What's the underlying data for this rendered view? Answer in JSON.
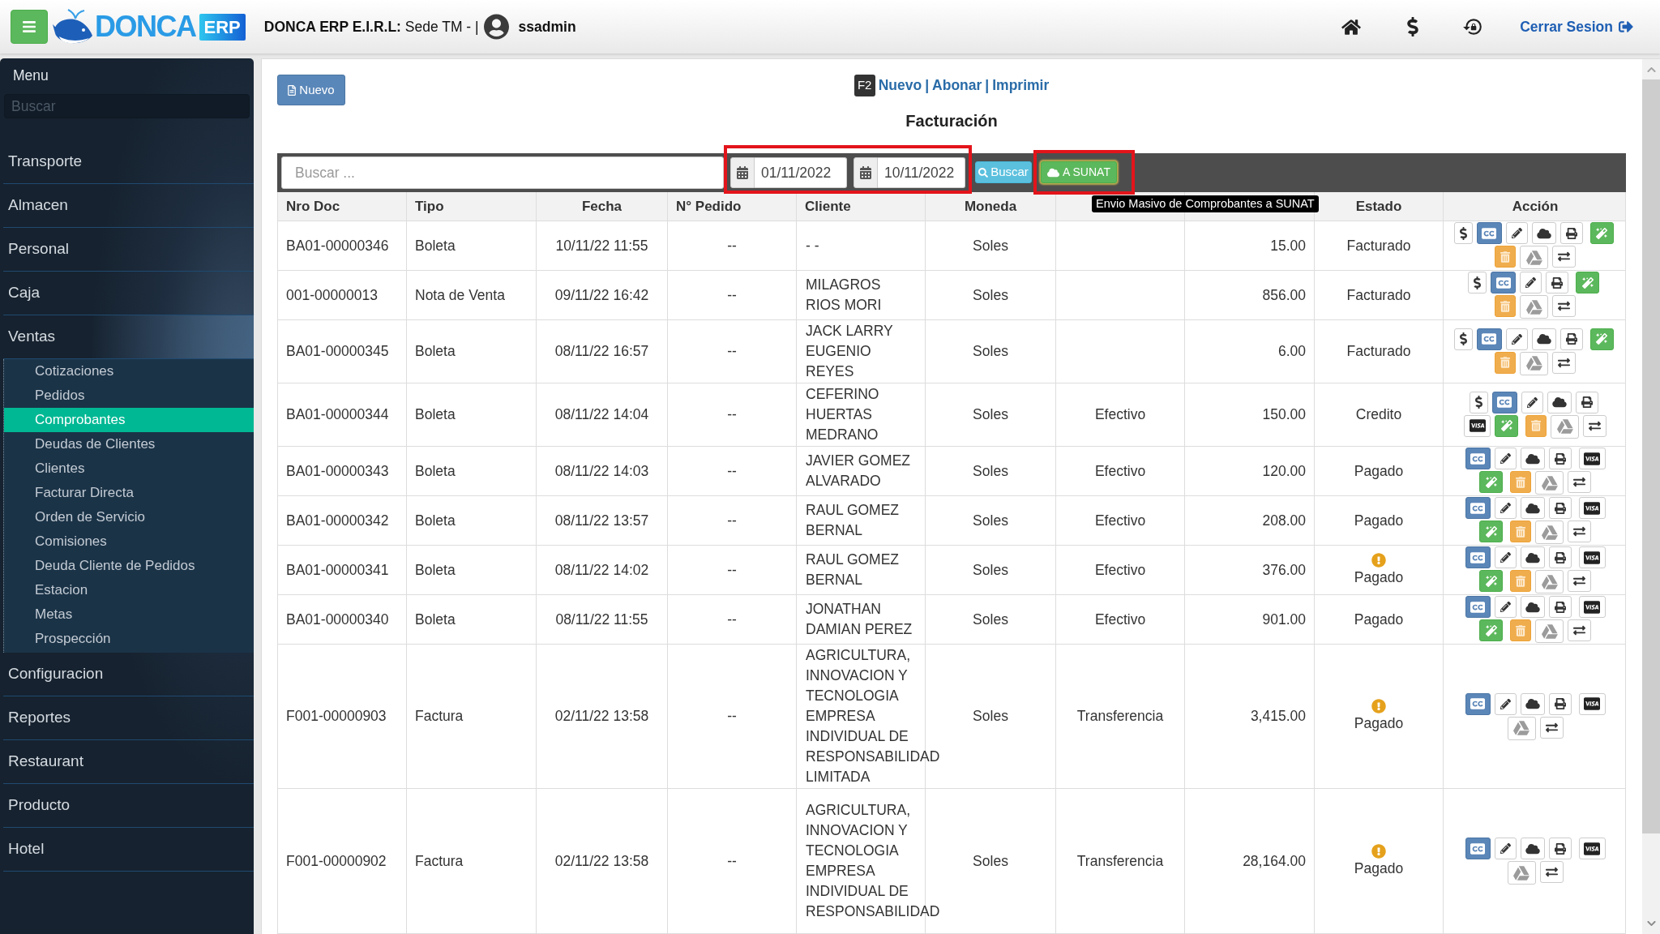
{
  "header": {
    "brand": {
      "name": "DONCA",
      "badge": "ERP"
    },
    "company": "**DONCA ERP E.I.R.L:** Sede TM - |",
    "user": "ssadmin",
    "logout": "Cerrar Sesion"
  },
  "sidebar": {
    "title": "Menu",
    "search": {
      "placeholder": "Buscar"
    },
    "items": [
      {
        "label": "Transporte",
        "expanded": false
      },
      {
        "label": "Almacen",
        "expanded": false
      },
      {
        "label": "Personal",
        "expanded": false
      },
      {
        "label": "Caja",
        "expanded": false
      },
      {
        "label": "Ventas",
        "expanded": true,
        "children": [
          {
            "label": "Cotizaciones",
            "selected": false
          },
          {
            "label": "Pedidos",
            "selected": false
          },
          {
            "label": "Comprobantes",
            "selected": true
          },
          {
            "label": "Deudas de Clientes",
            "selected": false
          },
          {
            "label": "Clientes",
            "selected": false
          },
          {
            "label": "Facturar Directa",
            "selected": false
          },
          {
            "label": "Orden de Servicio",
            "selected": false
          },
          {
            "label": "Comisiones",
            "selected": false
          },
          {
            "label": "Deuda Cliente de Pedidos",
            "selected": false
          },
          {
            "label": "Estacion",
            "selected": false
          },
          {
            "label": "Metas",
            "selected": false
          },
          {
            "label": "Prospección",
            "selected": false
          }
        ]
      },
      {
        "label": "Configuracion",
        "expanded": false
      },
      {
        "label": "Reportes",
        "expanded": false
      },
      {
        "label": "Restaurant",
        "expanded": false
      },
      {
        "label": "Producto",
        "expanded": false
      },
      {
        "label": "Hotel",
        "expanded": false
      }
    ]
  },
  "page": {
    "new_button": "Nuevo",
    "shortcut": {
      "key": "F2",
      "links": [
        {
          "label": "Nuevo",
          "separator": "|"
        },
        {
          "label": "Abonar",
          "separator": "|"
        },
        {
          "label": "Imprimir"
        }
      ]
    },
    "title": "Facturación"
  },
  "filters": {
    "search": {
      "placeholder": "Buscar ..."
    },
    "date_range": {
      "highlighted": true,
      "from": "01/11/2022",
      "to": "10/11/2022"
    },
    "search_button": "Buscar",
    "sunat_button": {
      "label": "A SUNAT",
      "highlighted": true
    },
    "tooltip": "Envio Masivo de Comprobantes a SUNAT"
  },
  "table": {
    "columns": [
      "Nro Doc",
      "Tipo",
      "Fecha",
      "N° Pedido",
      "Cliente",
      "Moneda",
      null,
      null,
      "Estado",
      "Acción"
    ],
    "rows": [
      {
        "nro_doc": "BA01-00000346",
        "tipo": "Boleta",
        "fecha": "10/11/22 11:55",
        "pedido": "--",
        "cliente": "- -",
        "moneda": "Soles",
        "column_8": "15.00",
        "estado": {
          "label": "Facturado",
          "warning": false
        },
        "actions": [
          [
            {
              "kind": "dollar"
            },
            {
              "kind": "cc"
            },
            {
              "kind": "edit"
            },
            {
              "kind": "cloud"
            },
            {
              "kind": "print"
            },
            {
              "kind": "wand"
            }
          ],
          [
            {
              "kind": "delete"
            },
            {
              "kind": "drive"
            },
            {
              "kind": "transfer"
            }
          ]
        ]
      },
      {
        "nro_doc": "001-00000013",
        "tipo": "Nota de Venta",
        "fecha": "09/11/22 16:42",
        "pedido": "--",
        "cliente": "MILAGROS RIOS MORI",
        "moneda": "Soles",
        "column_8": "856.00",
        "estado": {
          "label": "Facturado",
          "warning": false
        },
        "actions": [
          [
            {
              "kind": "dollar"
            },
            {
              "kind": "cc"
            },
            {
              "kind": "edit"
            },
            {
              "kind": "print"
            },
            {
              "kind": "wand"
            }
          ],
          [
            {
              "kind": "delete"
            },
            {
              "kind": "drive"
            },
            {
              "kind": "transfer"
            }
          ]
        ]
      },
      {
        "nro_doc": "BA01-00000345",
        "tipo": "Boleta",
        "fecha": "08/11/22 16:57",
        "pedido": "--",
        "cliente": "JACK LARRY EUGENIO REYES",
        "moneda": "Soles",
        "column_8": "6.00",
        "estado": {
          "label": "Facturado",
          "warning": false
        },
        "actions": [
          [
            {
              "kind": "dollar"
            },
            {
              "kind": "cc"
            },
            {
              "kind": "edit"
            },
            {
              "kind": "cloud"
            },
            {
              "kind": "print"
            },
            {
              "kind": "wand"
            }
          ],
          [
            {
              "kind": "delete"
            },
            {
              "kind": "drive"
            },
            {
              "kind": "transfer"
            }
          ]
        ]
      },
      {
        "nro_doc": "BA01-00000344",
        "tipo": "Boleta",
        "fecha": "08/11/22 14:04",
        "pedido": "--",
        "cliente": "CEFERINO HUERTAS MEDRANO",
        "moneda": "Soles",
        "column_7": "Efectivo",
        "column_8": "150.00",
        "estado": {
          "label": "Credito",
          "warning": false
        },
        "actions": [
          [
            {
              "kind": "dollar"
            },
            {
              "kind": "cc"
            },
            {
              "kind": "edit"
            },
            {
              "kind": "cloud"
            },
            {
              "kind": "print"
            }
          ],
          [
            {
              "kind": "visa"
            },
            {
              "kind": "wand"
            },
            {
              "kind": "delete"
            },
            {
              "kind": "drive"
            },
            {
              "kind": "transfer"
            }
          ]
        ]
      },
      {
        "nro_doc": "BA01-00000343",
        "tipo": "Boleta",
        "fecha": "08/11/22 14:03",
        "pedido": "--",
        "cliente": "JAVIER GOMEZ ALVARADO",
        "moneda": "Soles",
        "column_7": "Efectivo",
        "column_8": "120.00",
        "estado": {
          "label": "Pagado",
          "warning": false
        },
        "actions": [
          [
            {
              "kind": "cc"
            },
            {
              "kind": "edit"
            },
            {
              "kind": "cloud"
            },
            {
              "kind": "print"
            },
            {
              "kind": "visa"
            }
          ],
          [
            {
              "kind": "wand"
            },
            {
              "kind": "delete"
            },
            {
              "kind": "drive"
            },
            {
              "kind": "transfer"
            }
          ]
        ]
      },
      {
        "nro_doc": "BA01-00000342",
        "tipo": "Boleta",
        "fecha": "08/11/22 13:57",
        "pedido": "--",
        "cliente": "RAUL GOMEZ BERNAL",
        "moneda": "Soles",
        "column_7": "Efectivo",
        "column_8": "208.00",
        "estado": {
          "label": "Pagado",
          "warning": false
        },
        "actions": [
          [
            {
              "kind": "cc"
            },
            {
              "kind": "edit"
            },
            {
              "kind": "cloud"
            },
            {
              "kind": "print"
            },
            {
              "kind": "visa"
            }
          ],
          [
            {
              "kind": "wand"
            },
            {
              "kind": "delete"
            },
            {
              "kind": "drive"
            },
            {
              "kind": "transfer"
            }
          ]
        ]
      },
      {
        "nro_doc": "BA01-00000341",
        "tipo": "Boleta",
        "fecha": "08/11/22 14:02",
        "pedido": "--",
        "cliente": "RAUL GOMEZ BERNAL",
        "moneda": "Soles",
        "column_7": "Efectivo",
        "column_8": "376.00",
        "estado": {
          "label": "Pagado",
          "warning": true
        },
        "actions": [
          [
            {
              "kind": "cc"
            },
            {
              "kind": "edit"
            },
            {
              "kind": "cloud"
            },
            {
              "kind": "print"
            },
            {
              "kind": "visa"
            }
          ],
          [
            {
              "kind": "wand"
            },
            {
              "kind": "delete"
            },
            {
              "kind": "drive"
            },
            {
              "kind": "transfer"
            }
          ]
        ]
      },
      {
        "nro_doc": "BA01-00000340",
        "tipo": "Boleta",
        "fecha": "08/11/22 11:55",
        "pedido": "--",
        "cliente": "JONATHAN DAMIAN PEREZ",
        "moneda": "Soles",
        "column_7": "Efectivo",
        "column_8": "901.00",
        "estado": {
          "label": "Pagado",
          "warning": false
        },
        "actions": [
          [
            {
              "kind": "cc"
            },
            {
              "kind": "edit"
            },
            {
              "kind": "cloud"
            },
            {
              "kind": "print"
            },
            {
              "kind": "visa"
            }
          ],
          [
            {
              "kind": "wand"
            },
            {
              "kind": "delete"
            },
            {
              "kind": "drive"
            },
            {
              "kind": "transfer"
            }
          ]
        ]
      },
      {
        "nro_doc": "F001-00000903",
        "tipo": "Factura",
        "fecha": "02/11/22 13:58",
        "pedido": "--",
        "cliente": "AGRICULTURA, INNOVACION Y TECNOLOGIA EMPRESA INDIVIDUAL DE RESPONSABILIDAD LIMITADA",
        "moneda": "Soles",
        "column_7": "Transferencia",
        "column_8": "3,415.00",
        "estado": {
          "label": "Pagado",
          "warning": true
        },
        "actions": [
          [
            {
              "kind": "cc"
            },
            {
              "kind": "edit"
            },
            {
              "kind": "cloud"
            },
            {
              "kind": "print"
            },
            {
              "kind": "visa"
            }
          ],
          [
            {
              "kind": "drive"
            },
            {
              "kind": "transfer"
            }
          ]
        ]
      },
      {
        "nro_doc": "F001-00000902",
        "tipo": "Factura",
        "fecha": "02/11/22 13:58",
        "pedido": "--",
        "cliente": "AGRICULTURA, INNOVACION Y TECNOLOGIA EMPRESA INDIVIDUAL DE RESPONSABILIDAD",
        "moneda": "Soles",
        "column_7": "Transferencia",
        "column_8": "28,164.00",
        "estado": {
          "label": "Pagado",
          "warning": true
        },
        "actions": [
          [
            {
              "kind": "cc"
            },
            {
              "kind": "edit"
            },
            {
              "kind": "cloud"
            },
            {
              "kind": "print"
            },
            {
              "kind": "visa"
            }
          ],
          [
            {
              "kind": "drive"
            },
            {
              "kind": "transfer"
            }
          ]
        ]
      }
    ]
  }
}
